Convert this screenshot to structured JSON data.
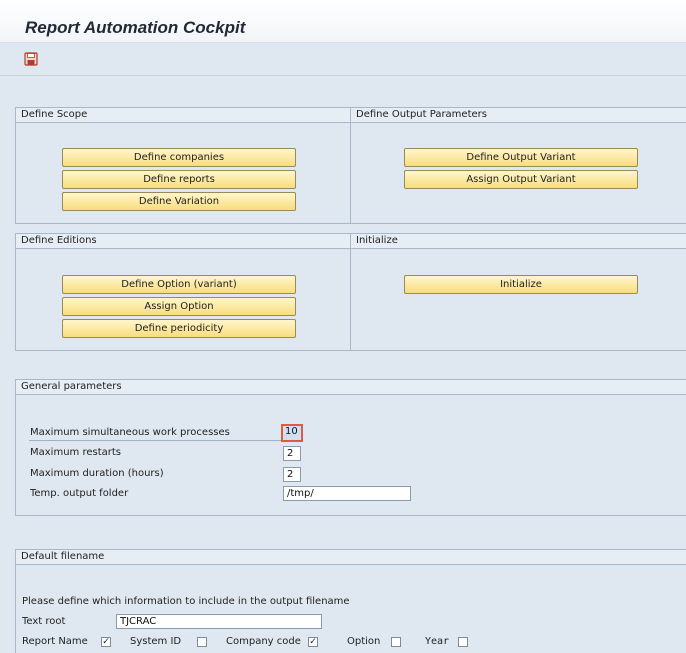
{
  "app": {
    "title": "Report Automation Cockpit"
  },
  "toolbar": {
    "save_icon": "save-icon"
  },
  "define_scope": {
    "header": "Define Scope",
    "buttons": [
      "Define companies",
      "Define reports",
      "Define Variation"
    ]
  },
  "define_output": {
    "header": "Define Output Parameters",
    "buttons": [
      "Define Output Variant",
      "Assign Output Variant"
    ]
  },
  "define_editions": {
    "header": "Define Editions",
    "buttons": [
      "Define Option (variant)",
      "Assign Option",
      "Define periodicity"
    ]
  },
  "initialize": {
    "header": "Initialize",
    "buttons": [
      "Initialize"
    ]
  },
  "general": {
    "header": "General parameters",
    "max_processes_label": "Maximum simultaneous work processes",
    "max_processes_value": "10",
    "max_restarts_label": "Maximum restarts",
    "max_restarts_value": "2",
    "max_duration_label": "Maximum duration (hours)",
    "max_duration_value": "2",
    "temp_folder_label": "Temp. output folder",
    "temp_folder_value": "/tmp/"
  },
  "filename": {
    "header": "Default filename",
    "instruction": "Please define which information to include in the output filename",
    "text_root_label": "Text root",
    "text_root_value": "TJCRAC",
    "checks": [
      {
        "label": "Report Name",
        "checked": true,
        "mark": "✓"
      },
      {
        "label": "System ID",
        "checked": false,
        "mark": ""
      },
      {
        "label": "Company code",
        "checked": true,
        "mark": "✓"
      },
      {
        "label": "Option",
        "checked": false,
        "mark": ""
      },
      {
        "label": "Year",
        "checked": false,
        "mark": ""
      }
    ]
  }
}
